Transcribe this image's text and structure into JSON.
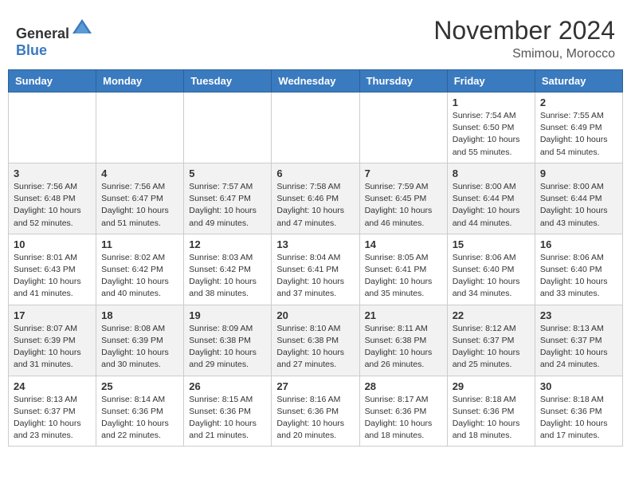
{
  "header": {
    "logo_general": "General",
    "logo_blue": "Blue",
    "month_year": "November 2024",
    "location": "Smimou, Morocco"
  },
  "weekdays": [
    "Sunday",
    "Monday",
    "Tuesday",
    "Wednesday",
    "Thursday",
    "Friday",
    "Saturday"
  ],
  "weeks": [
    [
      {
        "day": "",
        "info": ""
      },
      {
        "day": "",
        "info": ""
      },
      {
        "day": "",
        "info": ""
      },
      {
        "day": "",
        "info": ""
      },
      {
        "day": "",
        "info": ""
      },
      {
        "day": "1",
        "info": "Sunrise: 7:54 AM\nSunset: 6:50 PM\nDaylight: 10 hours\nand 55 minutes."
      },
      {
        "day": "2",
        "info": "Sunrise: 7:55 AM\nSunset: 6:49 PM\nDaylight: 10 hours\nand 54 minutes."
      }
    ],
    [
      {
        "day": "3",
        "info": "Sunrise: 7:56 AM\nSunset: 6:48 PM\nDaylight: 10 hours\nand 52 minutes."
      },
      {
        "day": "4",
        "info": "Sunrise: 7:56 AM\nSunset: 6:47 PM\nDaylight: 10 hours\nand 51 minutes."
      },
      {
        "day": "5",
        "info": "Sunrise: 7:57 AM\nSunset: 6:47 PM\nDaylight: 10 hours\nand 49 minutes."
      },
      {
        "day": "6",
        "info": "Sunrise: 7:58 AM\nSunset: 6:46 PM\nDaylight: 10 hours\nand 47 minutes."
      },
      {
        "day": "7",
        "info": "Sunrise: 7:59 AM\nSunset: 6:45 PM\nDaylight: 10 hours\nand 46 minutes."
      },
      {
        "day": "8",
        "info": "Sunrise: 8:00 AM\nSunset: 6:44 PM\nDaylight: 10 hours\nand 44 minutes."
      },
      {
        "day": "9",
        "info": "Sunrise: 8:00 AM\nSunset: 6:44 PM\nDaylight: 10 hours\nand 43 minutes."
      }
    ],
    [
      {
        "day": "10",
        "info": "Sunrise: 8:01 AM\nSunset: 6:43 PM\nDaylight: 10 hours\nand 41 minutes."
      },
      {
        "day": "11",
        "info": "Sunrise: 8:02 AM\nSunset: 6:42 PM\nDaylight: 10 hours\nand 40 minutes."
      },
      {
        "day": "12",
        "info": "Sunrise: 8:03 AM\nSunset: 6:42 PM\nDaylight: 10 hours\nand 38 minutes."
      },
      {
        "day": "13",
        "info": "Sunrise: 8:04 AM\nSunset: 6:41 PM\nDaylight: 10 hours\nand 37 minutes."
      },
      {
        "day": "14",
        "info": "Sunrise: 8:05 AM\nSunset: 6:41 PM\nDaylight: 10 hours\nand 35 minutes."
      },
      {
        "day": "15",
        "info": "Sunrise: 8:06 AM\nSunset: 6:40 PM\nDaylight: 10 hours\nand 34 minutes."
      },
      {
        "day": "16",
        "info": "Sunrise: 8:06 AM\nSunset: 6:40 PM\nDaylight: 10 hours\nand 33 minutes."
      }
    ],
    [
      {
        "day": "17",
        "info": "Sunrise: 8:07 AM\nSunset: 6:39 PM\nDaylight: 10 hours\nand 31 minutes."
      },
      {
        "day": "18",
        "info": "Sunrise: 8:08 AM\nSunset: 6:39 PM\nDaylight: 10 hours\nand 30 minutes."
      },
      {
        "day": "19",
        "info": "Sunrise: 8:09 AM\nSunset: 6:38 PM\nDaylight: 10 hours\nand 29 minutes."
      },
      {
        "day": "20",
        "info": "Sunrise: 8:10 AM\nSunset: 6:38 PM\nDaylight: 10 hours\nand 27 minutes."
      },
      {
        "day": "21",
        "info": "Sunrise: 8:11 AM\nSunset: 6:38 PM\nDaylight: 10 hours\nand 26 minutes."
      },
      {
        "day": "22",
        "info": "Sunrise: 8:12 AM\nSunset: 6:37 PM\nDaylight: 10 hours\nand 25 minutes."
      },
      {
        "day": "23",
        "info": "Sunrise: 8:13 AM\nSunset: 6:37 PM\nDaylight: 10 hours\nand 24 minutes."
      }
    ],
    [
      {
        "day": "24",
        "info": "Sunrise: 8:13 AM\nSunset: 6:37 PM\nDaylight: 10 hours\nand 23 minutes."
      },
      {
        "day": "25",
        "info": "Sunrise: 8:14 AM\nSunset: 6:36 PM\nDaylight: 10 hours\nand 22 minutes."
      },
      {
        "day": "26",
        "info": "Sunrise: 8:15 AM\nSunset: 6:36 PM\nDaylight: 10 hours\nand 21 minutes."
      },
      {
        "day": "27",
        "info": "Sunrise: 8:16 AM\nSunset: 6:36 PM\nDaylight: 10 hours\nand 20 minutes."
      },
      {
        "day": "28",
        "info": "Sunrise: 8:17 AM\nSunset: 6:36 PM\nDaylight: 10 hours\nand 18 minutes."
      },
      {
        "day": "29",
        "info": "Sunrise: 8:18 AM\nSunset: 6:36 PM\nDaylight: 10 hours\nand 18 minutes."
      },
      {
        "day": "30",
        "info": "Sunrise: 8:18 AM\nSunset: 6:36 PM\nDaylight: 10 hours\nand 17 minutes."
      }
    ]
  ]
}
